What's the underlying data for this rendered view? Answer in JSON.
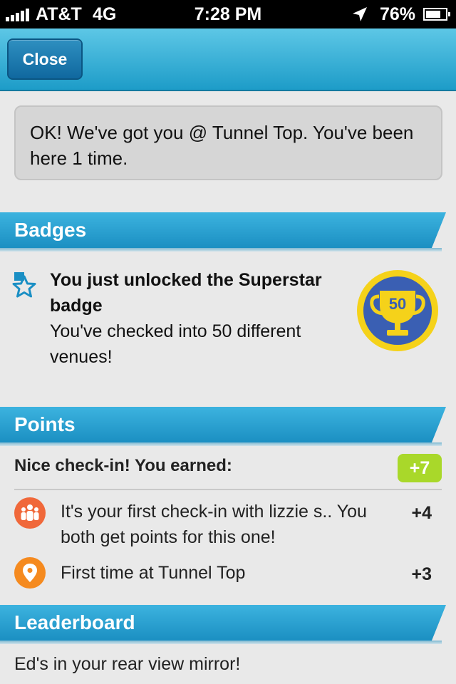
{
  "status_bar": {
    "carrier": "AT&T",
    "network": "4G",
    "time": "7:28 PM",
    "battery_percent": "76%",
    "battery_level": 0.76
  },
  "nav": {
    "close_label": "Close"
  },
  "message": {
    "text": "OK! We've got you @ Tunnel Top. You've been here 1 time."
  },
  "badges": {
    "header": "Badges",
    "title": "You just unlocked the Superstar badge",
    "description": "You've checked into 50 different venues!",
    "medal_label": "50"
  },
  "points": {
    "header": "Points",
    "summary": "Nice check-in! You earned:",
    "total": "+7",
    "items": [
      {
        "icon": "people-icon",
        "text": "It's your first check-in with lizzie s.. You both get points for this one!",
        "value": "+4"
      },
      {
        "icon": "location-pin-icon",
        "text": "First time at Tunnel Top",
        "value": "+3"
      }
    ]
  },
  "leaderboard": {
    "header": "Leaderboard",
    "text": "Ed's in your rear view mirror!"
  },
  "colors": {
    "header_blue": "#1b8fc2",
    "points_green": "#a9d82a",
    "people_icon_orange": "#f0683a",
    "pin_icon_orange": "#f58a1f",
    "medal_blue": "#3a5fb3",
    "medal_gold": "#f5d21a"
  }
}
